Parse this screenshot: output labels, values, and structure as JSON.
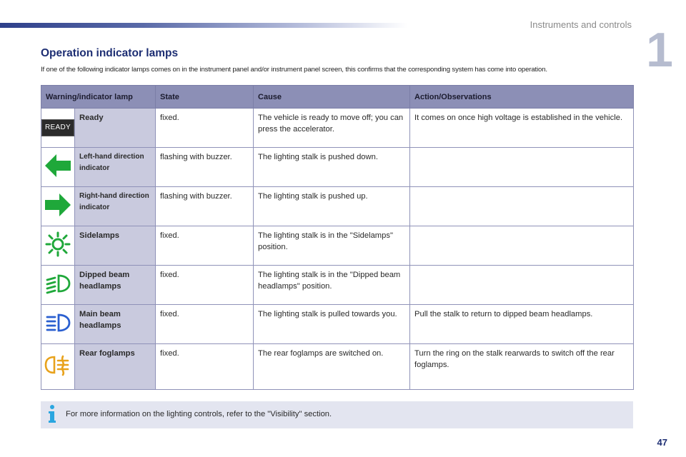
{
  "header": {
    "section_label": "Instruments and controls",
    "chapter_number": "1"
  },
  "page": {
    "title": "Operation indicator lamps",
    "intro": "If one of the following indicator lamps comes on in the instrument panel and/or instrument panel screen, this confirms that the corresponding system has come into operation.",
    "page_number": "47"
  },
  "table": {
    "headers": [
      "Warning/indicator lamp",
      "State",
      "Cause",
      "Action/Observations"
    ],
    "rows": [
      {
        "icon": "ready-badge-icon",
        "icon_text": "READY",
        "name": "Ready",
        "state": "fixed.",
        "cause": "The vehicle is ready to move off; you can press the accelerator.",
        "action": "It comes on once high voltage is established in the vehicle."
      },
      {
        "icon": "left-arrow-icon",
        "icon_color": "#1fa83a",
        "name": "Left-hand direction indicator",
        "state": "flashing with buzzer.",
        "cause": "The lighting stalk is pushed down.",
        "action": ""
      },
      {
        "icon": "right-arrow-icon",
        "icon_color": "#1fa83a",
        "name": "Right-hand direction indicator",
        "state": "flashing with buzzer.",
        "cause": "The lighting stalk is pushed up.",
        "action": ""
      },
      {
        "icon": "sidelamps-icon",
        "icon_color": "#1fa83a",
        "name": "Sidelamps",
        "state": "fixed.",
        "cause": "The lighting stalk is in the \"Sidelamps\" position.",
        "action": ""
      },
      {
        "icon": "dipped-beam-icon",
        "icon_color": "#1fa83a",
        "name": "Dipped beam headlamps",
        "state": "fixed.",
        "cause": "The lighting stalk is in the \"Dipped beam headlamps\" position.",
        "action": ""
      },
      {
        "icon": "main-beam-icon",
        "icon_color": "#2a5fd0",
        "name": "Main beam headlamps",
        "state": "fixed.",
        "cause": "The lighting stalk is pulled towards you.",
        "action": "Pull the stalk to return to dipped beam headlamps."
      },
      {
        "icon": "rear-foglamp-icon",
        "icon_color": "#e8a21c",
        "name": "Rear foglamps",
        "state": "fixed.",
        "cause": "The rear foglamps are switched on.",
        "action": "Turn the ring on the stalk rearwards to switch off the rear foglamps."
      }
    ]
  },
  "note": {
    "icon": "info-icon",
    "text": "For more information on the lighting controls, refer to the \"Visibility\" section."
  },
  "colors": {
    "title": "#1d2e73",
    "header_bg": "#8c8fb6",
    "name_col_bg": "#c9cade",
    "note_bg": "#e3e5f0",
    "info_icon": "#2aa6e0"
  }
}
